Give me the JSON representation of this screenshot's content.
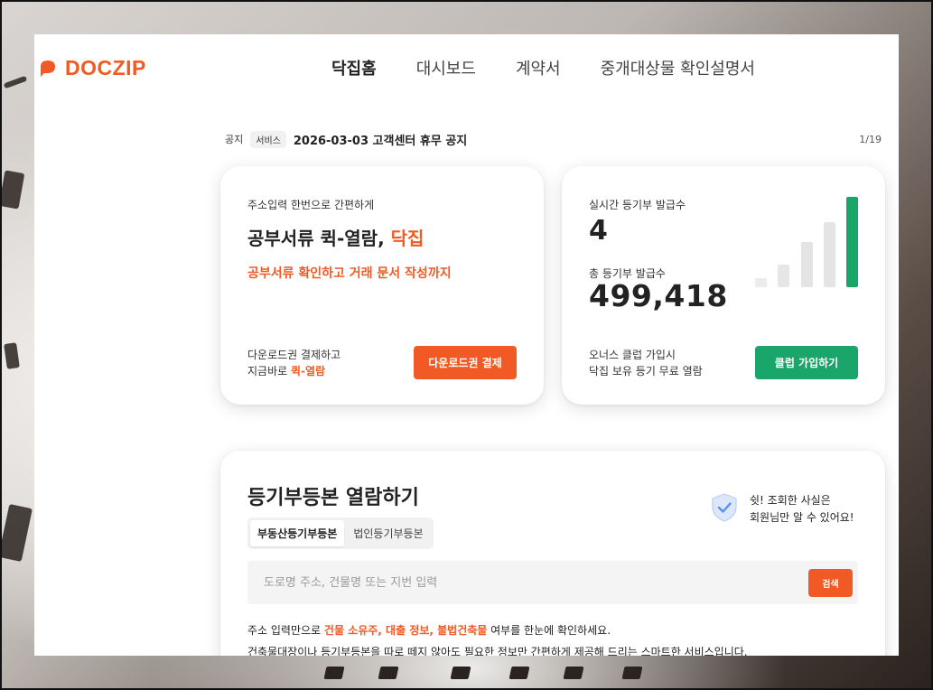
{
  "header": {
    "logo_text": "DOCZIP",
    "nav": [
      "닥집홈",
      "대시보드",
      "계약서",
      "중개대상물 확인설명서"
    ]
  },
  "notice": {
    "label": "공지",
    "badge": "서비스",
    "text": "2026-03-03 고객센터 휴무 공지",
    "page": "1/19"
  },
  "card_download": {
    "subtitle": "주소입력 한번으로 간편하게",
    "title_prefix": "공부서류 퀵-열람, ",
    "title_accent": "닥집",
    "desc": "공부서류 확인하고 거래 문서 작성까지",
    "foot_line1": "다운로드권 결제하고",
    "foot_line2_prefix": "지금바로 ",
    "foot_line2_accent": "퀵-열람",
    "button": "다운로드권 결제"
  },
  "card_stats": {
    "realtime_label": "실시간 등기부 발급수",
    "realtime_value": "4",
    "total_label": "총 등기부 발급수",
    "total_value": "499,418",
    "foot_line1": "오너스 클럽 가입시",
    "foot_line2": "닥집 보유 등기 무료 열람",
    "button": "클럽 가입하기",
    "bars": [
      {
        "level": 0.1,
        "color": "#ececec"
      },
      {
        "level": 0.25,
        "color": "#e6e6e6"
      },
      {
        "level": 0.5,
        "color": "#e4e4e4"
      },
      {
        "level": 0.72,
        "color": "#e4e4e4"
      },
      {
        "level": 1.0,
        "color": "#1aa56a"
      }
    ]
  },
  "card_registry": {
    "title": "등기부등본 열람하기",
    "tabs": [
      "부동산등기부등본",
      "법인등기부등본"
    ],
    "active_tab": 0,
    "shield_line1": "쉿! 조회한 사실은",
    "shield_line2": "회원님만 알 수 있어요!",
    "search_placeholder": "도로명 주소, 건물명 또는 지번 입력",
    "search_button": "검색",
    "info1_prefix": "주소 입력만으로 ",
    "info1_accent": "건물 소유주, 대출 정보, 불법건축물",
    "info1_suffix": " 여부를 한눈에 확인하세요.",
    "info2": "건축물대장이나 등기부등본을 따로 떼지 않아도 필요한 정보만 간편하게 제공해 드리는 스마트한 서비스입니다."
  },
  "colors": {
    "brand": "#f15a24",
    "green": "#1aa56a"
  }
}
